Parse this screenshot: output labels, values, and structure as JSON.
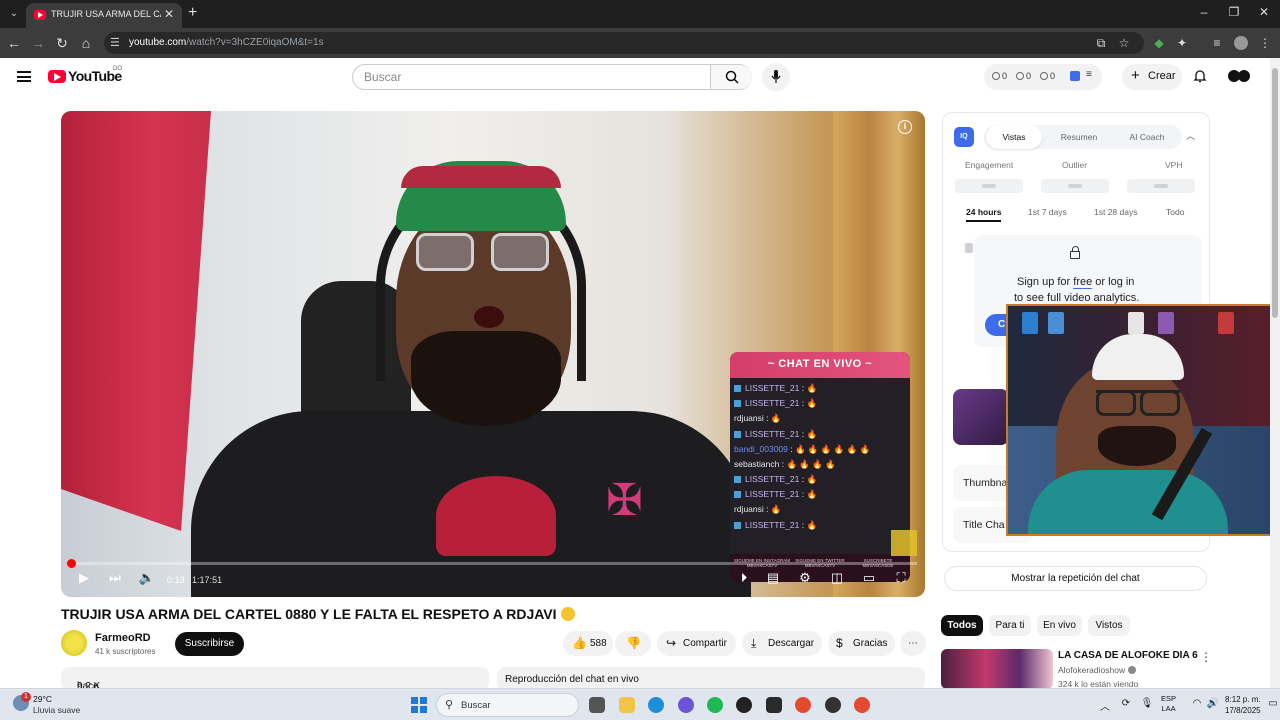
{
  "browser": {
    "tab_title": "TRUJIR USA ARMA DEL CARTEL 0880 Y LE FALTA EL RESPETO A RDJAVI",
    "url_host": "youtube.com",
    "url_path": "/watch?v=3hCZE0iqaOM&t=1s"
  },
  "youtube": {
    "logo_text": "YouTube",
    "region": "DO",
    "search_placeholder": "Buscar",
    "stats": {
      "a": "0",
      "b": "0",
      "c": "0"
    },
    "create_label": "Crear"
  },
  "video": {
    "chat_overlay": {
      "title": "~ CHAT EN VIVO ~",
      "lines": [
        {
          "user": "LISSETTE_21",
          "msg": "🔥"
        },
        {
          "user": "LISSETTE_21",
          "msg": "🔥"
        },
        {
          "user": "rdjuansi",
          "msg": "🔥"
        },
        {
          "user": "LISSETTE_21",
          "msg": "🔥"
        },
        {
          "user": "bandi_003009",
          "msg": "🔥 🔥 🔥 🔥 🔥 🔥"
        },
        {
          "user": "sebastianch",
          "msg": "🔥 🔥 🔥 🔥"
        },
        {
          "user": "LISSETTE_21",
          "msg": "🔥"
        },
        {
          "user": "LISSETTE_21",
          "msg": "🔥"
        },
        {
          "user": "rdjuansi",
          "msg": "🔥"
        },
        {
          "user": "LISSETTE_21",
          "msg": "🔥"
        }
      ],
      "footer": [
        "SIGUEME EN INSTAGRAM MBVASCASTV",
        "SIGUEME EN TWITTER MBVASCASTV",
        "SUSCRIBETE MBVASCASDE"
      ]
    },
    "current_time": "0:13",
    "duration": "1:17:51",
    "progress_fraction": 0.003
  },
  "meta": {
    "title": "TRUJIR USA ARMA DEL CARTEL 0880 Y LE FALTA EL RESPETO A RDJAVI",
    "channel_name": "FarmeoRD",
    "subscribers": "41 k suscriptores",
    "subscribe_label": "Suscribirse",
    "likes": "588",
    "share_label": "Compartir",
    "download_label": "Descargar",
    "thanks_label": "Gracias",
    "views": "9.2 K vistas",
    "posted": "hace 1 día",
    "chat_replay_label": "Reproducción del chat en vivo"
  },
  "vidiq": {
    "logo": "IQ",
    "tabs": [
      "Vistas",
      "Resumen",
      "AI Coach"
    ],
    "metrics": [
      "Engagement",
      "Outlier",
      "VPH"
    ],
    "ranges": [
      "24 hours",
      "1st 7 days",
      "1st 28 days",
      "Todo"
    ],
    "lock_line1_pre": "Sign up for ",
    "lock_line1_link": "free",
    "lock_line1_post": " or log in",
    "lock_line2": "to see full video analytics.",
    "cta_fragment": "C",
    "row_thumbnail": "Thumbna",
    "row_title": "Title Cha"
  },
  "sidebar": {
    "show_chat_label": "Mostrar la repetición del chat",
    "chips": [
      "Todos",
      "Para ti",
      "En vivo",
      "Vistos"
    ],
    "rec": {
      "title": "LA CASA DE ALOFOKE DIA 6",
      "channel": "Alofokeradioshow",
      "meta": "324 k lo están viendo"
    }
  },
  "taskbar": {
    "notif_count": "1",
    "temp": "29°C",
    "condition": "Lluvia suave",
    "search_label": "Buscar",
    "lang_1": "ESP",
    "lang_2": "LAA",
    "time": "8:12 p. m.",
    "date": "17/8/2025"
  }
}
